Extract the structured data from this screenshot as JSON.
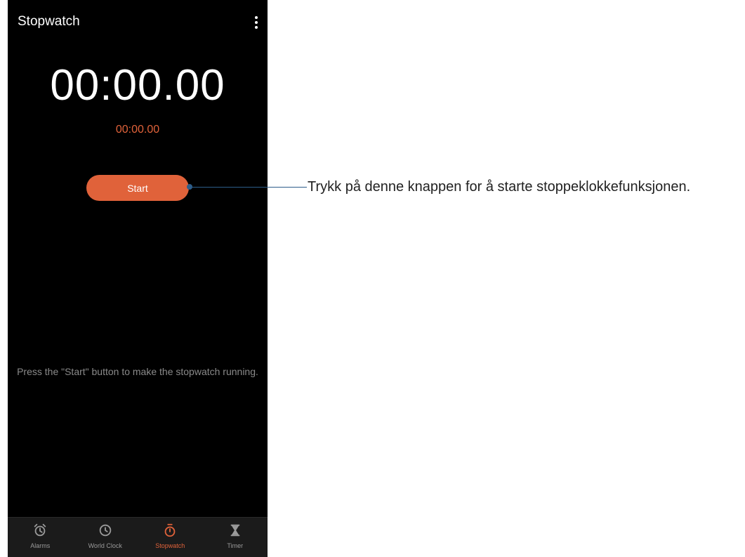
{
  "app": {
    "title": "Stopwatch"
  },
  "stopwatch": {
    "main_time": "00:00.00",
    "lap_time": "00:00.00",
    "start_label": "Start",
    "hint": "Press the \"Start\" button to make the stopwatch running."
  },
  "nav": {
    "items": [
      {
        "label": "Alarms",
        "icon": "alarm-icon"
      },
      {
        "label": "World Clock",
        "icon": "clock-icon"
      },
      {
        "label": "Stopwatch",
        "icon": "stopwatch-icon",
        "active": true
      },
      {
        "label": "Timer",
        "icon": "hourglass-icon"
      }
    ]
  },
  "callout": {
    "text": "Trykk på denne knappen for å starte stoppeklokkefunksjonen."
  },
  "colors": {
    "accent": "#e0623a",
    "background": "#000000",
    "callout_line": "#2d5d8a"
  }
}
